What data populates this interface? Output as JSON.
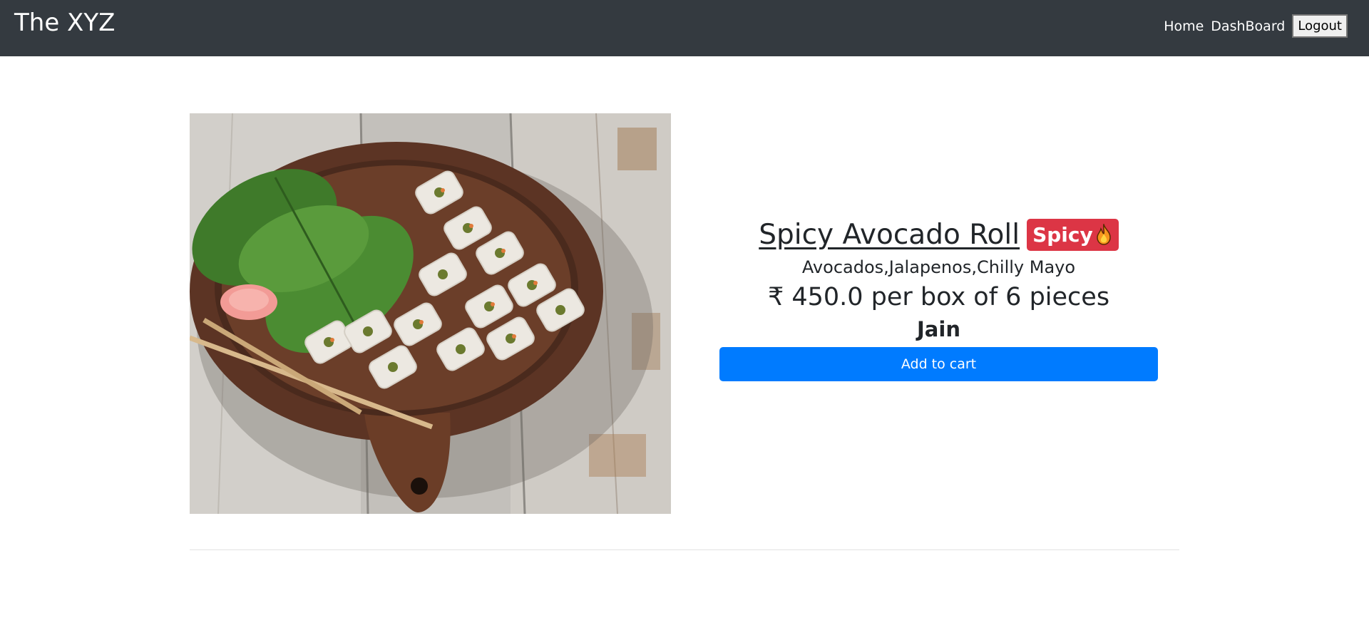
{
  "navbar": {
    "brand": "The XYZ",
    "links": [
      "Home",
      "DashBoard"
    ],
    "logout_label": "Logout",
    "background": "#343a40"
  },
  "product": {
    "title": "Spicy Avocado Roll",
    "badge": "Spicy",
    "badge_icon": "fire-icon",
    "badge_color": "#dc3545",
    "ingredients": "Avocados,Jalapenos,Chilly Mayo",
    "price": "₹ 450.0 per box of 6 pieces",
    "diet": "Jain",
    "add_to_cart_label": "Add to cart",
    "button_color": "#007bff",
    "image_alt": "sushi-platter-photo"
  }
}
